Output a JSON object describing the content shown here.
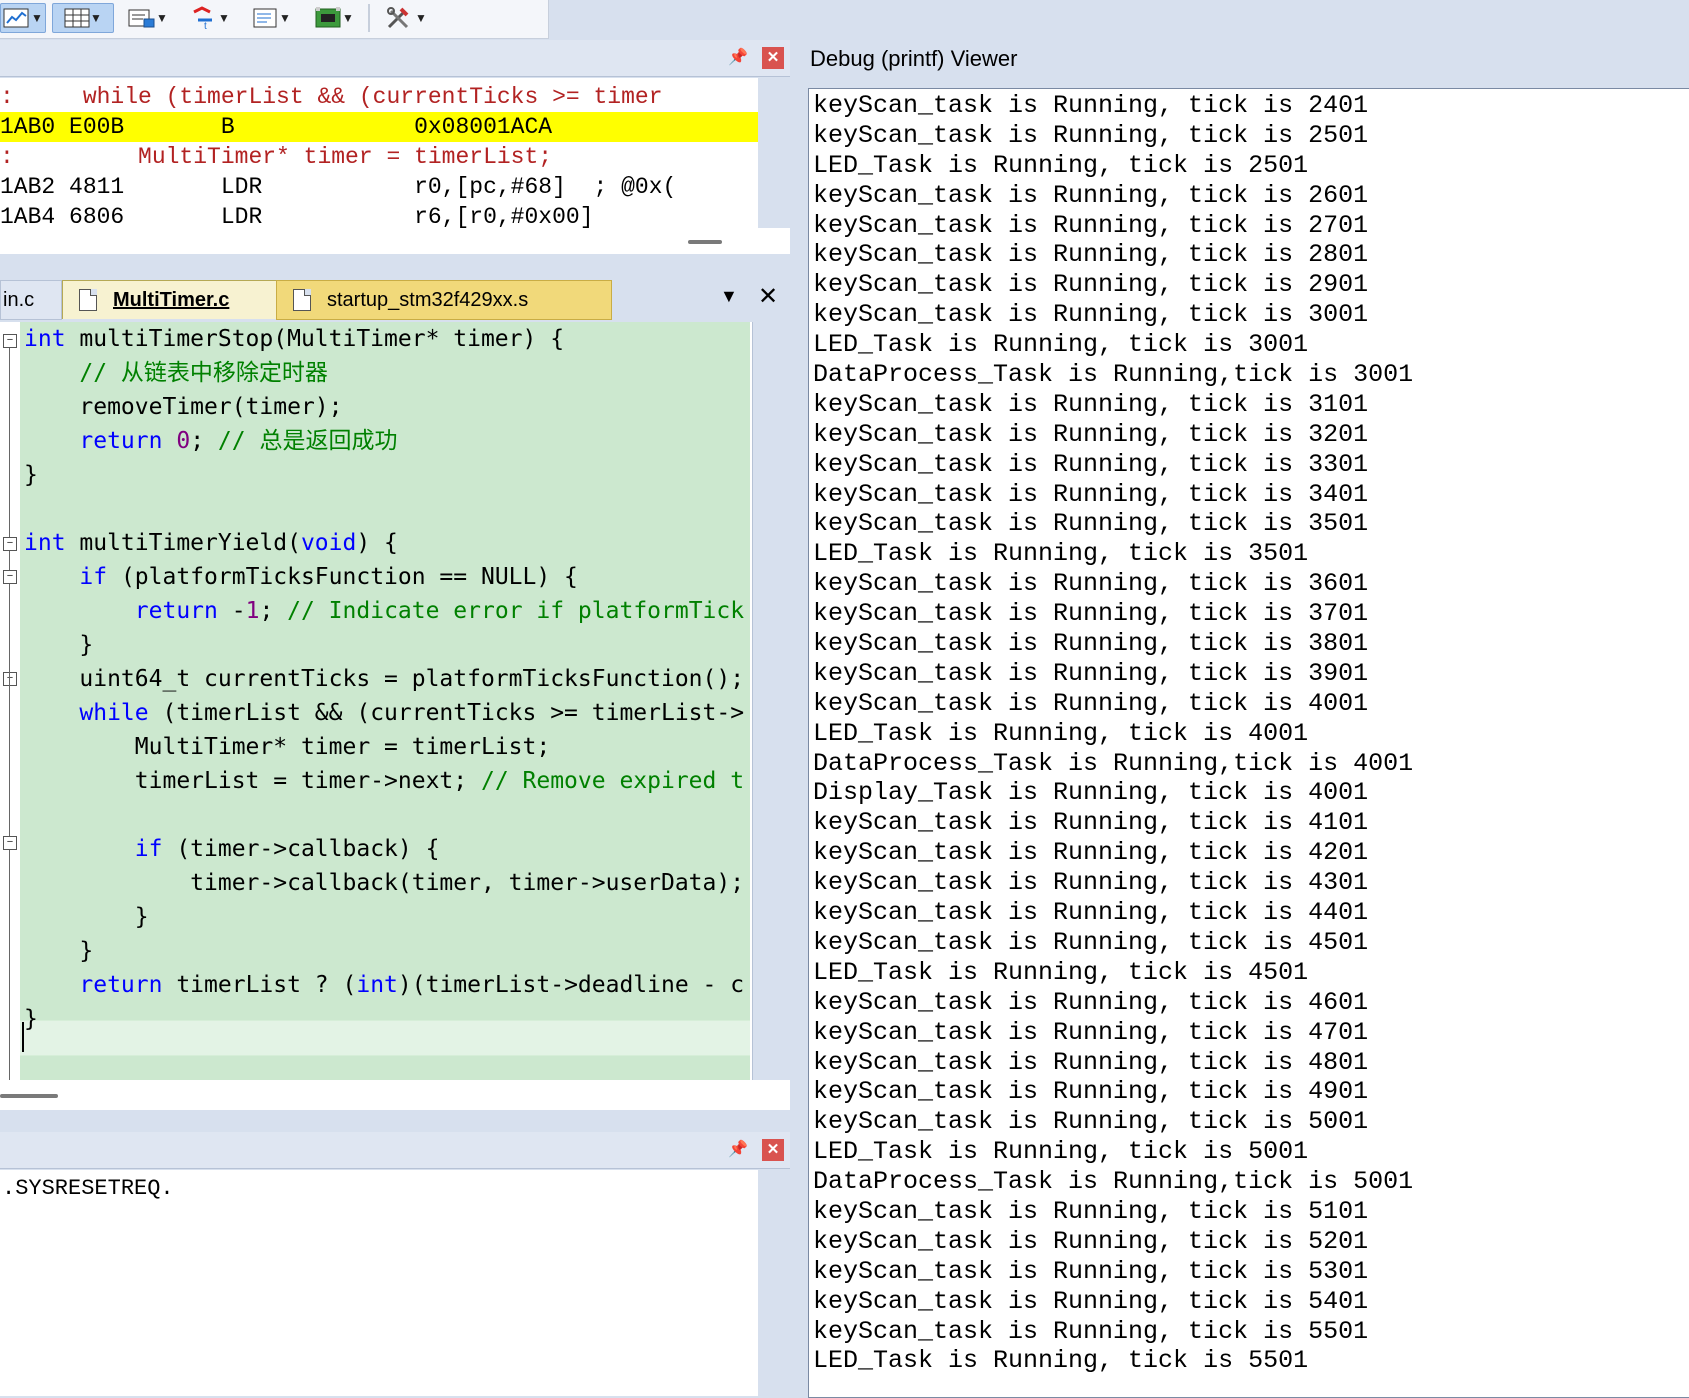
{
  "toolbar": {
    "buttons": [
      {
        "icon": "analysis-window-icon",
        "dropdown": true
      },
      {
        "icon": "memory-window-icon",
        "dropdown": true
      },
      {
        "icon": "serial-window-icon",
        "dropdown": true
      },
      {
        "icon": "trace-icon",
        "dropdown": true
      },
      {
        "icon": "system-viewer-icon",
        "dropdown": true
      },
      {
        "icon": "toolbox-icon",
        "dropdown": true
      },
      {
        "icon": "tools-icon",
        "dropdown": true
      }
    ]
  },
  "disassembly": {
    "lines": [
      {
        "kind": "src",
        "text": ":     while (timerList && (currentTicks >= timer"
      },
      {
        "kind": "hl",
        "text": "1AB0 E00B       B             0x08001ACA"
      },
      {
        "kind": "src",
        "text": ":         MultiTimer* timer = timerList;"
      },
      {
        "kind": "asm",
        "text": "1AB2 4811       LDR           r0,[pc,#68]  ; @0x("
      },
      {
        "kind": "asm",
        "text": "1AB4 6806       LDR           r6,[r0,#0x00]"
      }
    ]
  },
  "tabs": {
    "partial": "in.c",
    "active": "MultiTimer.c",
    "inactive": "startup_stm32f429xx.s",
    "menu_glyph": "▼",
    "close_glyph": "✕"
  },
  "editor": {
    "lines": [
      {
        "segments": [
          {
            "t": "int",
            "c": "kw"
          },
          {
            "t": " multiTimerStop(MultiTimer* timer) {",
            "c": ""
          }
        ]
      },
      {
        "segments": [
          {
            "t": "    // 从链表中移除定时器",
            "c": "cm"
          }
        ]
      },
      {
        "segments": [
          {
            "t": "    removeTimer(timer);",
            "c": ""
          }
        ]
      },
      {
        "segments": [
          {
            "t": "    ",
            "c": ""
          },
          {
            "t": "return",
            "c": "kw"
          },
          {
            "t": " ",
            "c": ""
          },
          {
            "t": "0",
            "c": "num"
          },
          {
            "t": "; ",
            "c": ""
          },
          {
            "t": "// 总是返回成功",
            "c": "cm"
          }
        ]
      },
      {
        "segments": [
          {
            "t": "}",
            "c": ""
          }
        ]
      },
      {
        "segments": [
          {
            "t": "",
            "c": ""
          }
        ]
      },
      {
        "segments": [
          {
            "t": "int",
            "c": "kw"
          },
          {
            "t": " multiTimerYield(",
            "c": ""
          },
          {
            "t": "void",
            "c": "kw"
          },
          {
            "t": ") {",
            "c": ""
          }
        ]
      },
      {
        "segments": [
          {
            "t": "    ",
            "c": ""
          },
          {
            "t": "if",
            "c": "kw"
          },
          {
            "t": " (platformTicksFunction == NULL) {",
            "c": ""
          }
        ]
      },
      {
        "segments": [
          {
            "t": "        ",
            "c": ""
          },
          {
            "t": "return",
            "c": "kw"
          },
          {
            "t": " -",
            "c": ""
          },
          {
            "t": "1",
            "c": "num"
          },
          {
            "t": "; ",
            "c": ""
          },
          {
            "t": "// Indicate error if platformTick",
            "c": "cm"
          }
        ]
      },
      {
        "segments": [
          {
            "t": "    }",
            "c": ""
          }
        ]
      },
      {
        "segments": [
          {
            "t": "    uint64_t currentTicks = platformTicksFunction();",
            "c": ""
          }
        ]
      },
      {
        "segments": [
          {
            "t": "    ",
            "c": ""
          },
          {
            "t": "while",
            "c": "kw"
          },
          {
            "t": " (timerList && (currentTicks >= timerList->",
            "c": ""
          }
        ]
      },
      {
        "segments": [
          {
            "t": "        MultiTimer* timer = timerList;",
            "c": ""
          }
        ]
      },
      {
        "segments": [
          {
            "t": "        timerList = timer->next; ",
            "c": ""
          },
          {
            "t": "// Remove expired t",
            "c": "cm"
          }
        ]
      },
      {
        "segments": [
          {
            "t": "",
            "c": ""
          }
        ]
      },
      {
        "segments": [
          {
            "t": "        ",
            "c": ""
          },
          {
            "t": "if",
            "c": "kw"
          },
          {
            "t": " (timer->callback) {",
            "c": ""
          }
        ]
      },
      {
        "segments": [
          {
            "t": "            timer->callback(timer, timer->userData);",
            "c": ""
          }
        ]
      },
      {
        "segments": [
          {
            "t": "        }",
            "c": ""
          }
        ]
      },
      {
        "segments": [
          {
            "t": "    }",
            "c": ""
          }
        ]
      },
      {
        "segments": [
          {
            "t": "    ",
            "c": ""
          },
          {
            "t": "return",
            "c": "kw"
          },
          {
            "t": " timerList ? (",
            "c": ""
          },
          {
            "t": "int",
            "c": "kw"
          },
          {
            "t": ")(timerList->deadline - c",
            "c": ""
          }
        ]
      },
      {
        "segments": [
          {
            "t": "}",
            "c": ""
          }
        ]
      }
    ]
  },
  "output": {
    "text": ".SYSRESETREQ."
  },
  "debug_viewer": {
    "title": "Debug (printf) Viewer",
    "lines": [
      "keyScan_task is Running, tick is 2401",
      "keyScan_task is Running, tick is 2501",
      "LED_Task is Running, tick is 2501",
      "keyScan_task is Running, tick is 2601",
      "keyScan_task is Running, tick is 2701",
      "keyScan_task is Running, tick is 2801",
      "keyScan_task is Running, tick is 2901",
      "keyScan_task is Running, tick is 3001",
      "LED_Task is Running, tick is 3001",
      "DataProcess_Task is Running,tick is 3001",
      "keyScan_task is Running, tick is 3101",
      "keyScan_task is Running, tick is 3201",
      "keyScan_task is Running, tick is 3301",
      "keyScan_task is Running, tick is 3401",
      "keyScan_task is Running, tick is 3501",
      "LED_Task is Running, tick is 3501",
      "keyScan_task is Running, tick is 3601",
      "keyScan_task is Running, tick is 3701",
      "keyScan_task is Running, tick is 3801",
      "keyScan_task is Running, tick is 3901",
      "keyScan_task is Running, tick is 4001",
      "LED_Task is Running, tick is 4001",
      "DataProcess_Task is Running,tick is 4001",
      "Display_Task is Running, tick is 4001",
      "keyScan_task is Running, tick is 4101",
      "keyScan_task is Running, tick is 4201",
      "keyScan_task is Running, tick is 4301",
      "keyScan_task is Running, tick is 4401",
      "keyScan_task is Running, tick is 4501",
      "LED_Task is Running, tick is 4501",
      "keyScan_task is Running, tick is 4601",
      "keyScan_task is Running, tick is 4701",
      "keyScan_task is Running, tick is 4801",
      "keyScan_task is Running, tick is 4901",
      "keyScan_task is Running, tick is 5001",
      "LED_Task is Running, tick is 5001",
      "DataProcess_Task is Running,tick is 5001",
      "keyScan_task is Running, tick is 5101",
      "keyScan_task is Running, tick is 5201",
      "keyScan_task is Running, tick is 5301",
      "keyScan_task is Running, tick is 5401",
      "keyScan_task is Running, tick is 5501",
      "LED_Task is Running, tick is 5501"
    ]
  },
  "colors": {
    "code_background": "#cce8cf",
    "keyword": "#0000ff",
    "comment": "#008000",
    "highlight": "#ffff00",
    "source_line": "#b22222",
    "close_button": "#d9534f"
  }
}
